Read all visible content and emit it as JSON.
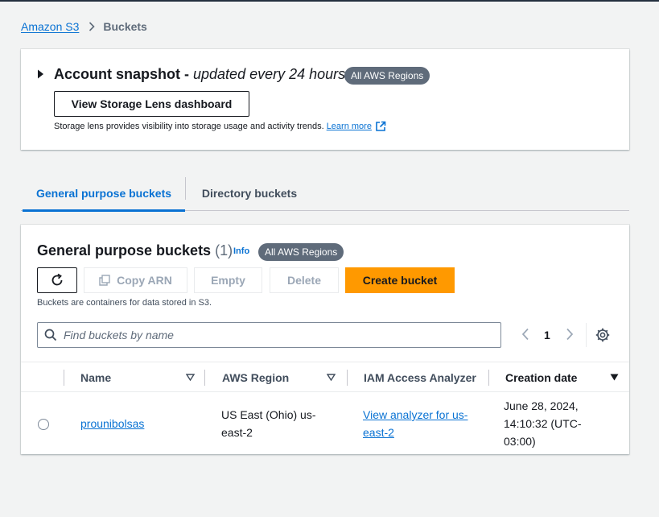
{
  "breadcrumb": {
    "root": "Amazon S3",
    "current": "Buckets"
  },
  "snapshot": {
    "title": "Account snapshot - ",
    "title_italic": "updated every 24 hours",
    "badge": "All AWS Regions",
    "button": "View Storage Lens dashboard",
    "description": "Storage lens provides visibility into storage usage and activity trends.",
    "learn_more": "Learn more"
  },
  "tabs": {
    "general": "General purpose buckets",
    "directory": "Directory buckets"
  },
  "buckets_panel": {
    "title": "General purpose buckets",
    "count": "(1)",
    "info": "Info",
    "badge": "All AWS Regions",
    "actions": {
      "copy_arn": "Copy ARN",
      "empty": "Empty",
      "delete": "Delete",
      "create": "Create bucket"
    },
    "description": "Buckets are containers for data stored in S3.",
    "search_placeholder": "Find buckets by name",
    "page": "1"
  },
  "table": {
    "columns": {
      "name": "Name",
      "region": "AWS Region",
      "iam": "IAM Access Analyzer",
      "date": "Creation date"
    },
    "rows": [
      {
        "name": "prounibolsas",
        "region": "US East (Ohio) us-east-2",
        "iam": "View analyzer for us-east-2",
        "date": "June 28, 2024, 14:10:32 (UTC-03:00)"
      }
    ]
  },
  "colors": {
    "link": "#0972d3",
    "primary": "#ff9900",
    "badge": "#5f6b7a"
  }
}
